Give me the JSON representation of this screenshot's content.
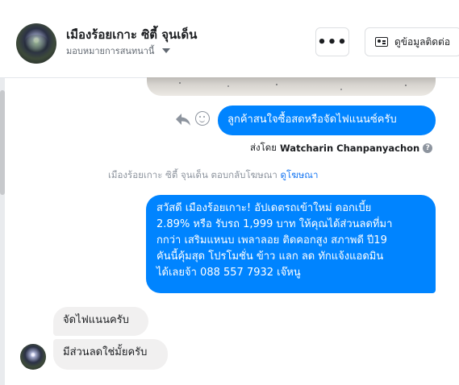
{
  "header": {
    "title": "เมืองร้อยเกาะ ซิตี้ จุนเด็น",
    "subtitle": "มอบหมายการสนทนานี้",
    "more_label": "•••",
    "info_button_label": "ดูข้อมูลติดต่อ"
  },
  "conversation": {
    "outgoing_1": "ลูกค้าสนใจซื้อสดหรือจัดไฟแนนซ์ครับ",
    "sent_by_prefix": "ส่งโดย",
    "sent_by_name": "Watcharin Chanpanyachon",
    "replied_ad_text": "เมืองร้อยเกาะ ซิตี้ จุนเด็น ตอบกลับโฆษณา",
    "replied_ad_link": "ดูโฆษณา",
    "outgoing_2_lines": [
      "สวัสดี เมืองร้อยเกาะ! อัปเดตรถเข้าใหม่ ดอกเบี้ย",
      "2.89% หรือ รับรถ 1,999 บาท ให้คุณได้ส่วนลดที่มา",
      "กกว่า เสริมแหนบ เพลาลอย ติดคอกสูง สภาพดี ปี19",
      "คันนี้คุ้มสุด โปรโมชั่น ข้าว แลก ลด ทักแจ้งแอดมิน",
      "ได้เลยจ้า 088 557 7932 เจ๊หนู"
    ],
    "incoming_1": "จัดไฟแนนครับ",
    "incoming_2": "มีส่วนลดใช่มั้ยครับ"
  },
  "icons": {
    "reply": "reply-icon",
    "emoji": "emoji-icon",
    "info": "question-icon",
    "contact": "id-card-icon"
  },
  "colors": {
    "outgoing_bubble": "#0084ff",
    "incoming_bubble": "#f1f0f0",
    "link": "#1877f2"
  }
}
